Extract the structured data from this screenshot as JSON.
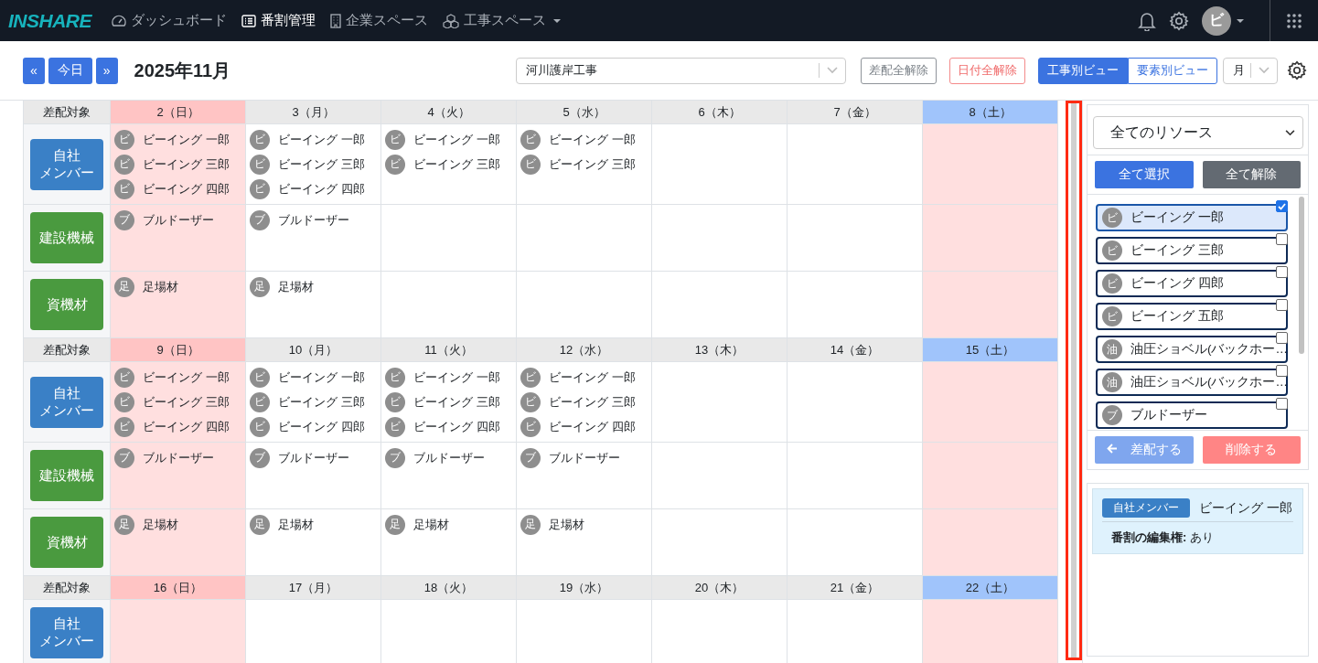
{
  "navbar": {
    "logo": "INSHARE",
    "items": [
      {
        "label": "ダッシュボード",
        "selected": false,
        "dropdown": false
      },
      {
        "label": "番割管理",
        "selected": true,
        "dropdown": false
      },
      {
        "label": "企業スペース",
        "selected": false,
        "dropdown": false
      },
      {
        "label": "工事スペース",
        "selected": false,
        "dropdown": true
      }
    ],
    "avatar": "ビ"
  },
  "toolbar": {
    "prev": "«",
    "today": "今日",
    "next": "»",
    "title": "2025年11月",
    "project_select": "河川護岸工事",
    "clear_assign": "差配全解除",
    "clear_dates": "日付全解除",
    "views": [
      {
        "label": "工事別ビュー",
        "selected": true
      },
      {
        "label": "要素別ビュー",
        "selected": false
      }
    ],
    "period_select": "月"
  },
  "calendar": {
    "weeks": [
      {
        "corner_label": "差配対象",
        "days": [
          {
            "label": "2（日）",
            "kind": "sunday"
          },
          {
            "label": "3（月）",
            "kind": "weekday"
          },
          {
            "label": "4（火）",
            "kind": "weekday"
          },
          {
            "label": "5（水）",
            "kind": "weekday"
          },
          {
            "label": "6（木）",
            "kind": "weekday"
          },
          {
            "label": "7（金）",
            "kind": "weekday"
          },
          {
            "label": "8（土）",
            "kind": "saturday"
          }
        ],
        "rows": [
          {
            "category_lines": [
              "自社",
              "メンバー"
            ],
            "color": "#3a80c6",
            "cells": [
              [
                {
                  "initial": "ビ",
                  "name": "ビーイング 一郎"
                },
                {
                  "initial": "ビ",
                  "name": "ビーイング 三郎"
                },
                {
                  "initial": "ビ",
                  "name": "ビーイング 四郎"
                }
              ],
              [
                {
                  "initial": "ビ",
                  "name": "ビーイング 一郎"
                },
                {
                  "initial": "ビ",
                  "name": "ビーイング 三郎"
                },
                {
                  "initial": "ビ",
                  "name": "ビーイング 四郎"
                }
              ],
              [
                {
                  "initial": "ビ",
                  "name": "ビーイング 一郎"
                },
                {
                  "initial": "ビ",
                  "name": "ビーイング 三郎"
                }
              ],
              [
                {
                  "initial": "ビ",
                  "name": "ビーイング 一郎"
                },
                {
                  "initial": "ビ",
                  "name": "ビーイング 三郎"
                }
              ],
              [],
              [],
              []
            ]
          },
          {
            "category_lines": [
              "建設機械"
            ],
            "color": "#4a9a3f",
            "cells": [
              [
                {
                  "initial": "ブ",
                  "name": "ブルドーザー"
                }
              ],
              [
                {
                  "initial": "ブ",
                  "name": "ブルドーザー"
                }
              ],
              [],
              [],
              [],
              [],
              []
            ]
          },
          {
            "category_lines": [
              "資機材"
            ],
            "color": "#4a9a3f",
            "cells": [
              [
                {
                  "initial": "足",
                  "name": "足場材"
                }
              ],
              [
                {
                  "initial": "足",
                  "name": "足場材"
                }
              ],
              [],
              [],
              [],
              [],
              []
            ]
          }
        ]
      },
      {
        "corner_label": "差配対象",
        "days": [
          {
            "label": "9（日）",
            "kind": "sunday"
          },
          {
            "label": "10（月）",
            "kind": "weekday"
          },
          {
            "label": "11（火）",
            "kind": "weekday"
          },
          {
            "label": "12（水）",
            "kind": "weekday"
          },
          {
            "label": "13（木）",
            "kind": "weekday"
          },
          {
            "label": "14（金）",
            "kind": "weekday"
          },
          {
            "label": "15（土）",
            "kind": "saturday"
          }
        ],
        "rows": [
          {
            "category_lines": [
              "自社",
              "メンバー"
            ],
            "color": "#3a80c6",
            "cells": [
              [
                {
                  "initial": "ビ",
                  "name": "ビーイング 一郎"
                },
                {
                  "initial": "ビ",
                  "name": "ビーイング 三郎"
                },
                {
                  "initial": "ビ",
                  "name": "ビーイング 四郎"
                }
              ],
              [
                {
                  "initial": "ビ",
                  "name": "ビーイング 一郎"
                },
                {
                  "initial": "ビ",
                  "name": "ビーイング 三郎"
                },
                {
                  "initial": "ビ",
                  "name": "ビーイング 四郎"
                }
              ],
              [
                {
                  "initial": "ビ",
                  "name": "ビーイング 一郎"
                },
                {
                  "initial": "ビ",
                  "name": "ビーイング 三郎"
                },
                {
                  "initial": "ビ",
                  "name": "ビーイング 四郎"
                }
              ],
              [
                {
                  "initial": "ビ",
                  "name": "ビーイング 一郎"
                },
                {
                  "initial": "ビ",
                  "name": "ビーイング 三郎"
                },
                {
                  "initial": "ビ",
                  "name": "ビーイング 四郎"
                }
              ],
              [],
              [],
              []
            ]
          },
          {
            "category_lines": [
              "建設機械"
            ],
            "color": "#4a9a3f",
            "cells": [
              [
                {
                  "initial": "ブ",
                  "name": "ブルドーザー"
                }
              ],
              [
                {
                  "initial": "ブ",
                  "name": "ブルドーザー"
                }
              ],
              [
                {
                  "initial": "ブ",
                  "name": "ブルドーザー"
                }
              ],
              [
                {
                  "initial": "ブ",
                  "name": "ブルドーザー"
                }
              ],
              [],
              [],
              []
            ]
          },
          {
            "category_lines": [
              "資機材"
            ],
            "color": "#4a9a3f",
            "cells": [
              [
                {
                  "initial": "足",
                  "name": "足場材"
                }
              ],
              [
                {
                  "initial": "足",
                  "name": "足場材"
                }
              ],
              [
                {
                  "initial": "足",
                  "name": "足場材"
                }
              ],
              [
                {
                  "initial": "足",
                  "name": "足場材"
                }
              ],
              [],
              [],
              []
            ]
          }
        ]
      },
      {
        "corner_label": "差配対象",
        "days": [
          {
            "label": "16（日）",
            "kind": "sunday"
          },
          {
            "label": "17（月）",
            "kind": "weekday"
          },
          {
            "label": "18（火）",
            "kind": "weekday"
          },
          {
            "label": "19（水）",
            "kind": "weekday"
          },
          {
            "label": "20（木）",
            "kind": "weekday"
          },
          {
            "label": "21（金）",
            "kind": "weekday"
          },
          {
            "label": "22（土）",
            "kind": "saturday"
          }
        ],
        "rows": [
          {
            "category_lines": [
              "自社",
              "メンバー"
            ],
            "color": "#3a80c6",
            "cells": [
              [],
              [],
              [],
              [],
              [],
              [],
              []
            ]
          }
        ]
      }
    ]
  },
  "resource_panel": {
    "filter_select": "全てのリソース",
    "select_all": "全て選択",
    "clear_all": "全て解除",
    "resources": [
      {
        "initial": "ビ",
        "name": "ビーイング 一郎",
        "checked": true
      },
      {
        "initial": "ビ",
        "name": "ビーイング 三郎",
        "checked": false
      },
      {
        "initial": "ビ",
        "name": "ビーイング 四郎",
        "checked": false
      },
      {
        "initial": "ビ",
        "name": "ビーイング 五郎",
        "checked": false
      },
      {
        "initial": "油",
        "name": "油圧ショベル(バックホー…",
        "checked": false
      },
      {
        "initial": "油",
        "name": "油圧ショベル(バックホー…",
        "checked": false
      },
      {
        "initial": "ブ",
        "name": "ブルドーザー",
        "checked": false
      }
    ],
    "assign": "差配する",
    "delete": "削除する",
    "detail": {
      "badge": "自社メンバー",
      "name": "ビーイング 一郎",
      "permission_label": "番割の編集権:",
      "permission_value": "あり"
    }
  }
}
